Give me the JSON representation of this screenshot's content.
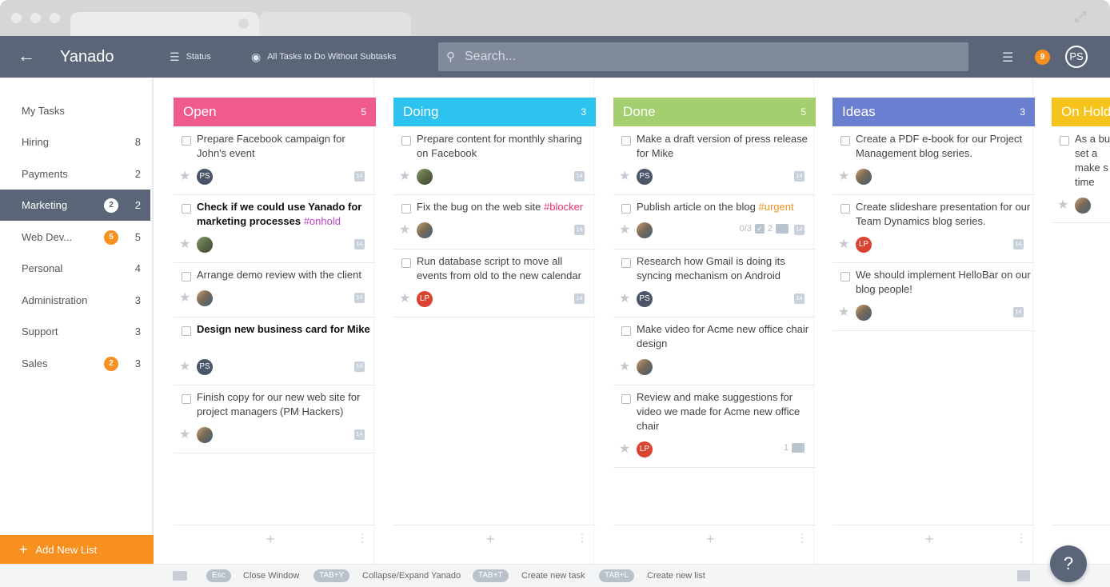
{
  "header": {
    "back_icon": "arrow-left-icon",
    "title": "Yanado",
    "status_label": "Status",
    "view_label": "All Tasks to Do Without Subtasks",
    "search_placeholder": "Search...",
    "notification_count": "9",
    "user_initials": "PS"
  },
  "sidebar": {
    "items": [
      {
        "label": "My Tasks",
        "count": "",
        "badge": ""
      },
      {
        "label": "Hiring",
        "count": "8",
        "badge": ""
      },
      {
        "label": "Payments",
        "count": "2",
        "badge": ""
      },
      {
        "label": "Marketing",
        "count": "2",
        "badge": "2"
      },
      {
        "label": "Web Dev...",
        "count": "5",
        "badge": "5"
      },
      {
        "label": "Personal",
        "count": "4",
        "badge": ""
      },
      {
        "label": "Administration",
        "count": "3",
        "badge": ""
      },
      {
        "label": "Support",
        "count": "3",
        "badge": ""
      },
      {
        "label": "Sales",
        "count": "3",
        "badge": "2"
      }
    ],
    "add_list_label": "Add New List"
  },
  "columns": [
    {
      "title": "Open",
      "count": "5",
      "color": "#f05a8c",
      "cards": [
        {
          "text": "Prepare Facebook campaign for John's event",
          "tag": "",
          "bold": false,
          "assignee": "PS",
          "cal": "14",
          "meta": ""
        },
        {
          "text": "Check if we could use Yanado for marketing processes ",
          "tag": "#onhold",
          "bold": true,
          "assignee": "",
          "cal": "14",
          "meta": ""
        },
        {
          "text": "Arrange demo review with the client",
          "tag": "",
          "bold": false,
          "assignee": "",
          "cal": "14",
          "meta": ""
        },
        {
          "text": "Design new business card for Mike",
          "tag": "",
          "bold": true,
          "assignee": "PS",
          "cal": "14",
          "meta": ""
        },
        {
          "text": "Finish copy for our new web site for project managers (PM Hackers)",
          "tag": "",
          "bold": false,
          "assignee": "",
          "cal": "14",
          "meta": ""
        }
      ]
    },
    {
      "title": "Doing",
      "count": "3",
      "color": "#2ec3ef",
      "cards": [
        {
          "text": "Prepare content for monthly sharing on Facebook",
          "tag": "",
          "bold": false,
          "assignee": "",
          "cal": "14",
          "meta": ""
        },
        {
          "text": "Fix the bug on the web site ",
          "tag": "#blocker",
          "bold": false,
          "assignee": "",
          "cal": "14",
          "meta": ""
        },
        {
          "text": "Run database script to move all events from old to the new calendar",
          "tag": "",
          "bold": false,
          "assignee": "LP",
          "cal": "14",
          "meta": ""
        }
      ]
    },
    {
      "title": "Done",
      "count": "5",
      "color": "#a3cf6e",
      "cards": [
        {
          "text": "Make a draft version of press release for Mike",
          "tag": "",
          "bold": false,
          "assignee": "PS",
          "cal": "14",
          "meta": ""
        },
        {
          "text": "Publish article on the blog ",
          "tag": "#urgent",
          "bold": false,
          "assignee": "",
          "cal": "14",
          "meta": "0/3",
          "meta2": "2"
        },
        {
          "text": "Research how Gmail is doing its syncing mechanism on Android",
          "tag": "",
          "bold": false,
          "assignee": "PS",
          "cal": "14",
          "meta": ""
        },
        {
          "text": "Make video for Acme new office chair design",
          "tag": "",
          "bold": false,
          "assignee": "",
          "cal": "",
          "meta": ""
        },
        {
          "text": "Review and make suggestions for video we made for Acme new office chair",
          "tag": "",
          "bold": false,
          "assignee": "LP",
          "cal": "",
          "meta": "1"
        }
      ]
    },
    {
      "title": "Ideas",
      "count": "3",
      "color": "#6b7fd0",
      "cards": [
        {
          "text": "Create a PDF e-book for our Project Management blog series.",
          "tag": "",
          "bold": false,
          "assignee": "",
          "cal": "",
          "meta": ""
        },
        {
          "text": "Create slideshare presentation for our Team Dynamics blog series.",
          "tag": "",
          "bold": false,
          "assignee": "LP",
          "cal": "14",
          "meta": ""
        },
        {
          "text": "We should implement HelloBar on our blog people!",
          "tag": "",
          "bold": false,
          "assignee": "",
          "cal": "14",
          "meta": ""
        }
      ]
    },
    {
      "title": "On Hold",
      "count": "",
      "color": "#f6c21c",
      "cards": [
        {
          "text": "As a bu to set a make s on time",
          "tag": "",
          "bold": false,
          "assignee": "",
          "cal": "",
          "meta": ""
        }
      ]
    }
  ],
  "tag_colors": {
    "#onhold": "#c03fd0",
    "#blocker": "#e8306b",
    "#urgent": "#f7901e"
  },
  "footer": {
    "keys": [
      {
        "key": "Esc",
        "label": "Close Window"
      },
      {
        "key": "TAB+Y",
        "label": "Collapse/Expand Yanado"
      },
      {
        "key": "TAB+T",
        "label": "Create new task"
      },
      {
        "key": "TAB+L",
        "label": "Create new list"
      }
    ]
  },
  "help_icon": "question-icon"
}
